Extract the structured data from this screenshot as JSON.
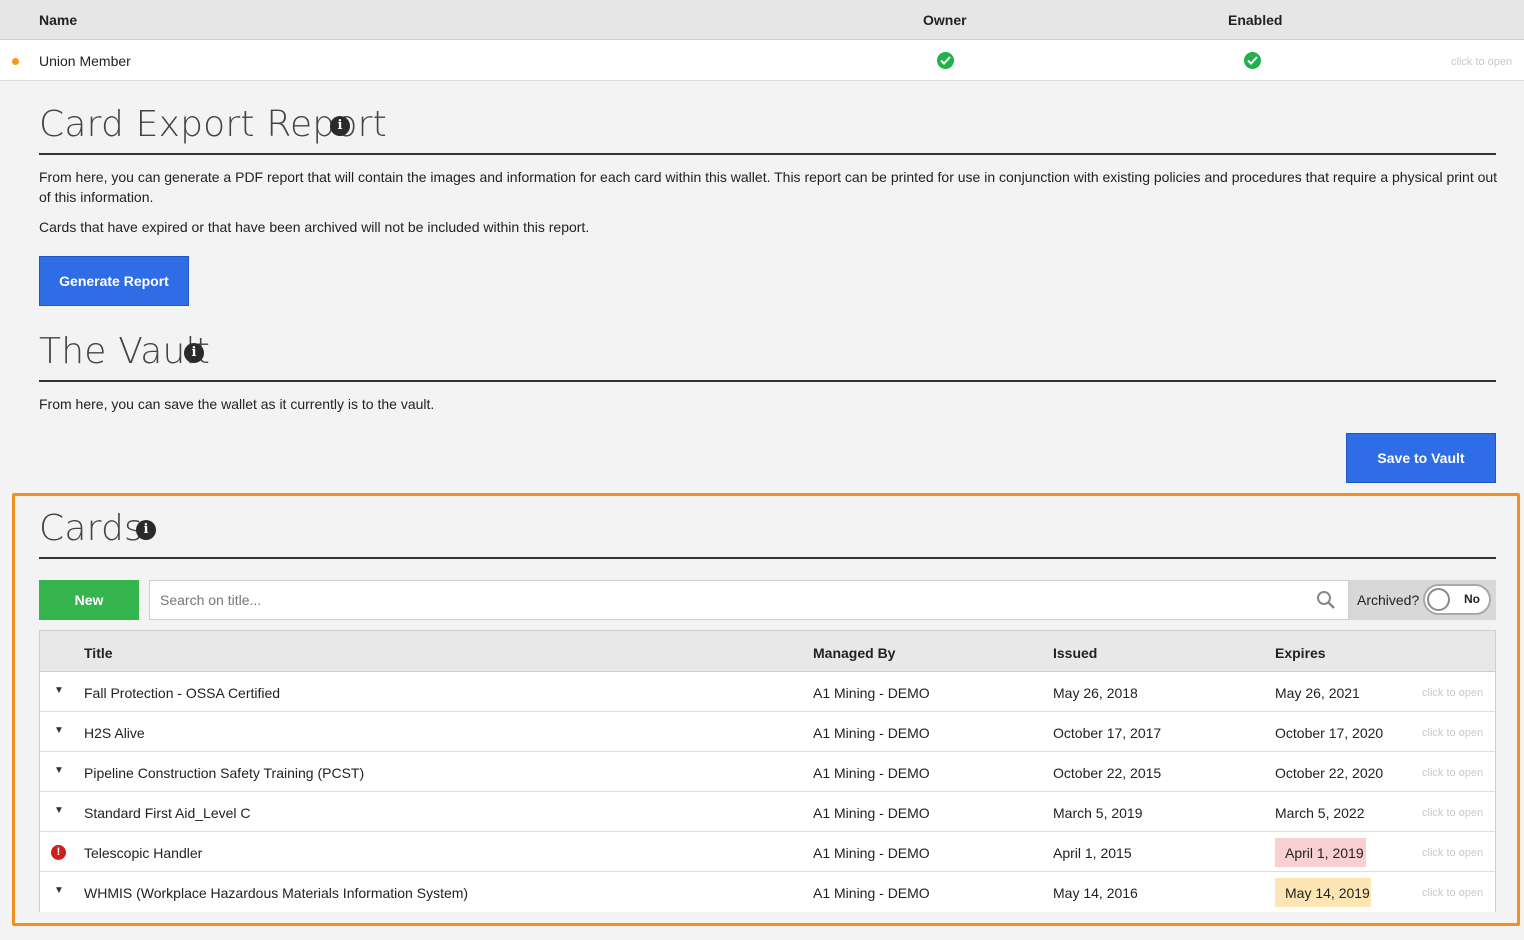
{
  "members": {
    "headers": {
      "name": "Name",
      "owner": "Owner",
      "enabled": "Enabled"
    },
    "rows": [
      {
        "name": "Union Member",
        "owner": true,
        "enabled": true,
        "hint": "click to open",
        "status_color": "#f39a1f"
      }
    ]
  },
  "card_export": {
    "title": "Card Export Report",
    "paragraph1": "From here, you can generate a PDF report that will contain the images and information for each card within this wallet. This report can be printed for use in conjunction with existing policies and procedures that require a physical print out of this information.",
    "paragraph2": "Cards that have expired or that have been archived will not be included within this report.",
    "button_label": "Generate Report"
  },
  "vault": {
    "title": "The Vault",
    "paragraph": "From here, you can save the wallet as it currently is to the vault.",
    "button_label": "Save to Vault"
  },
  "cards": {
    "title": "Cards",
    "new_label": "New",
    "search_placeholder": "Search on title...",
    "archived_label": "Archived?",
    "archived_toggle": "No",
    "columns": {
      "title": "Title",
      "managed_by": "Managed By",
      "issued": "Issued",
      "expires": "Expires"
    },
    "hint": "click to open",
    "rows": [
      {
        "title": "Fall Protection - OSSA Certified",
        "managed_by": "A1 Mining - DEMO",
        "issued": "May 26, 2018",
        "expires": "May 26, 2021",
        "status": "normal"
      },
      {
        "title": "H2S Alive",
        "managed_by": "A1 Mining - DEMO",
        "issued": "October 17, 2017",
        "expires": "October 17, 2020",
        "status": "normal"
      },
      {
        "title": "Pipeline Construction Safety Training (PCST)",
        "managed_by": "A1 Mining - DEMO",
        "issued": "October 22, 2015",
        "expires": "October 22, 2020",
        "status": "normal"
      },
      {
        "title": "Standard First Aid_Level C",
        "managed_by": "A1 Mining - DEMO",
        "issued": "March 5, 2019",
        "expires": "March 5, 2022",
        "status": "normal"
      },
      {
        "title": "Telescopic Handler",
        "managed_by": "A1 Mining - DEMO",
        "issued": "April 1, 2015",
        "expires": "April 1, 2019",
        "status": "expired"
      },
      {
        "title": "WHMIS (Workplace Hazardous Materials Information System)",
        "managed_by": "A1 Mining - DEMO",
        "issued": "May 14, 2016",
        "expires": "May 14, 2019",
        "status": "warning"
      }
    ]
  },
  "colors": {
    "primary_blue": "#2f6de6",
    "new_green": "#36b44e",
    "check_green": "#21b04b",
    "highlight_orange": "#f0901e",
    "expired_bg": "#f8d0d2",
    "warning_bg": "#fde6b4",
    "alert_red": "#cc1f1f"
  },
  "icons": {
    "info": "info-icon",
    "check": "check-circle-icon",
    "search": "search-icon",
    "expand": "caret-down-icon",
    "alert": "alert-circle-icon"
  }
}
